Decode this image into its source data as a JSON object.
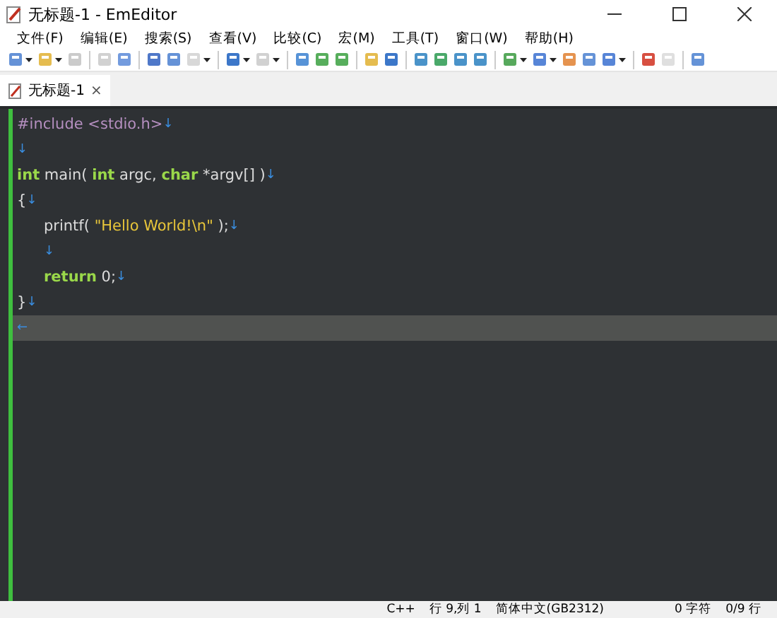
{
  "window": {
    "title": "无标题-1 - EmEditor"
  },
  "menu": [
    "文件(F)",
    "编辑(E)",
    "搜索(S)",
    "查看(V)",
    "比较(C)",
    "宏(M)",
    "工具(T)",
    "窗口(W)",
    "帮助(H)"
  ],
  "toolbar": [
    {
      "buttons": [
        {
          "dropdown": true,
          "disabled": false
        },
        {
          "dropdown": true,
          "disabled": false
        },
        {
          "dropdown": false,
          "disabled": true
        }
      ]
    },
    {
      "buttons": [
        {
          "dropdown": false,
          "disabled": true
        },
        {
          "dropdown": false,
          "disabled": false
        }
      ]
    },
    {
      "buttons": [
        {
          "dropdown": false,
          "disabled": false
        },
        {
          "dropdown": false,
          "disabled": false
        },
        {
          "dropdown": true,
          "disabled": true
        }
      ]
    },
    {
      "buttons": [
        {
          "dropdown": true,
          "disabled": false
        },
        {
          "dropdown": true,
          "disabled": true
        }
      ]
    },
    {
      "buttons": [
        {
          "dropdown": false,
          "disabled": false
        },
        {
          "dropdown": false,
          "disabled": false
        },
        {
          "dropdown": false,
          "disabled": false
        }
      ]
    },
    {
      "buttons": [
        {
          "dropdown": false,
          "disabled": false
        },
        {
          "dropdown": false,
          "disabled": false
        }
      ]
    },
    {
      "buttons": [
        {
          "dropdown": false,
          "disabled": false
        },
        {
          "dropdown": false,
          "disabled": false
        },
        {
          "dropdown": false,
          "disabled": false
        },
        {
          "dropdown": false,
          "disabled": false
        }
      ]
    },
    {
      "buttons": [
        {
          "dropdown": true,
          "disabled": false
        },
        {
          "dropdown": true,
          "disabled": false
        },
        {
          "dropdown": false,
          "disabled": false
        },
        {
          "dropdown": false,
          "disabled": false
        },
        {
          "dropdown": true,
          "disabled": false
        }
      ]
    },
    {
      "buttons": [
        {
          "dropdown": false,
          "disabled": false
        },
        {
          "dropdown": false,
          "disabled": true
        }
      ]
    },
    {
      "buttons": [
        {
          "dropdown": false,
          "disabled": false
        }
      ]
    }
  ],
  "tabs": [
    {
      "label": "无标题-1",
      "selected": true,
      "close": "×"
    }
  ],
  "editor": {
    "lines": [
      {
        "current": false,
        "tokens": [
          {
            "kind": "directive",
            "text": "#include <stdio.h>"
          },
          {
            "kind": "eol",
            "text": "↓"
          }
        ]
      },
      {
        "current": false,
        "tokens": [
          {
            "kind": "eol",
            "text": "↓"
          }
        ]
      },
      {
        "current": false,
        "tokens": [
          {
            "kind": "keyword",
            "text": "int"
          },
          {
            "kind": "plain",
            "text": " main( "
          },
          {
            "kind": "keyword",
            "text": "int"
          },
          {
            "kind": "plain",
            "text": " argc, "
          },
          {
            "kind": "keyword",
            "text": "char"
          },
          {
            "kind": "plain",
            "text": " *argv[] )"
          },
          {
            "kind": "eol",
            "text": "↓"
          }
        ]
      },
      {
        "current": false,
        "tokens": [
          {
            "kind": "plain",
            "text": "{"
          },
          {
            "kind": "eol",
            "text": "↓"
          }
        ]
      },
      {
        "current": false,
        "tokens": [
          {
            "kind": "indent"
          },
          {
            "kind": "plain",
            "text": "printf( "
          },
          {
            "kind": "string",
            "text": "\"Hello World!\\n\""
          },
          {
            "kind": "plain",
            "text": " );"
          },
          {
            "kind": "eol",
            "text": "↓"
          }
        ]
      },
      {
        "current": false,
        "tokens": [
          {
            "kind": "indent"
          },
          {
            "kind": "eol",
            "text": "↓"
          }
        ]
      },
      {
        "current": false,
        "tokens": [
          {
            "kind": "indent"
          },
          {
            "kind": "keyword",
            "text": "return"
          },
          {
            "kind": "plain",
            "text": " 0;"
          },
          {
            "kind": "eol",
            "text": "↓"
          }
        ]
      },
      {
        "current": false,
        "tokens": [
          {
            "kind": "plain",
            "text": "}"
          },
          {
            "kind": "eol",
            "text": "↓"
          }
        ]
      },
      {
        "current": true,
        "tokens": [
          {
            "kind": "eof",
            "text": "←"
          }
        ]
      }
    ]
  },
  "status_bar": [
    "C++",
    "行 9,列 1",
    "简体中文(GB2312)",
    "0 字符",
    "0/9 行"
  ]
}
